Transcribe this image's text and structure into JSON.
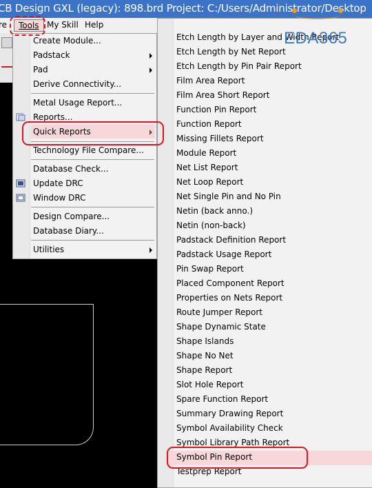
{
  "title_bar": {
    "text": "CB Design GXL (legacy): 898.brd  Project: C:/Users/Administrator/Desktop"
  },
  "menu_bar": {
    "items": [
      {
        "label": "re"
      },
      {
        "label": "Tools"
      },
      {
        "label": "My Skill"
      },
      {
        "label": "Help"
      }
    ]
  },
  "tools_menu": {
    "items": [
      {
        "label": "Create Module..."
      },
      {
        "label": "Padstack"
      },
      {
        "label": "Pad"
      },
      {
        "label": "Derive Connectivity..."
      },
      {
        "label": "Metal Usage Report..."
      },
      {
        "label": "Reports..."
      },
      {
        "label": "Quick Reports"
      },
      {
        "label": "Technology File Compare..."
      },
      {
        "label": "Database Check..."
      },
      {
        "label": "Update DRC"
      },
      {
        "label": "Window DRC"
      },
      {
        "label": "Design Compare..."
      },
      {
        "label": "Database Diary..."
      },
      {
        "label": "Utilities"
      }
    ]
  },
  "quick_reports": {
    "items": [
      "Etch Length by Layer and Width Report",
      "Etch Length by Net Report",
      "Etch Length by Pin Pair Report",
      "Film Area Report",
      "Film Area Short Report",
      "Function Pin Report",
      "Function Report",
      "Missing Fillets Report",
      "Module Report",
      "Net List Report",
      "Net Loop Report",
      "Net Single Pin and No Pin",
      "Netin (back anno.)",
      "Netin (non-back)",
      "Padstack Definition Report",
      "Padstack Usage Report",
      "Pin Swap Report",
      "Placed Component Report",
      "Properties on Nets Report",
      "Route Jumper Report",
      "Shape Dynamic State",
      "Shape Islands",
      "Shape No Net",
      "Shape Report",
      "Slot Hole Report",
      "Spare Function Report",
      "Summary Drawing Report",
      "Symbol Availability Check",
      "Symbol Library Path Report",
      "Symbol Pin Report",
      "Testprep Report"
    ]
  },
  "watermark": {
    "text": "EDA365"
  },
  "colors": {
    "highlight": "#f7d7da",
    "annotation": "#e0141e",
    "titlebar": "#3b73c9",
    "logo": "#3b79c2"
  }
}
